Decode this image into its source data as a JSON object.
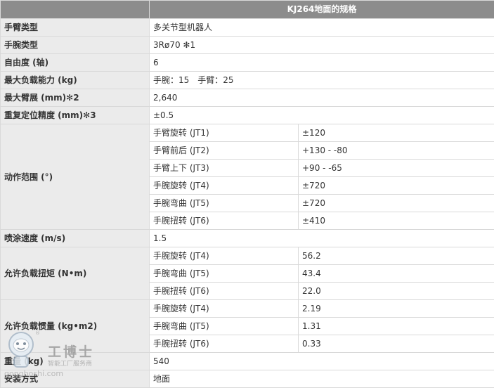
{
  "table": {
    "header": "KJ264地面的规格",
    "rows": [
      {
        "label": "手臂类型",
        "value": "多关节型机器人"
      },
      {
        "label": "手腕类型",
        "value": "3Rø70 ✻1"
      },
      {
        "label": "自由度 (轴)",
        "value": "6"
      },
      {
        "label": "最大负载能力 (kg)",
        "value": "手腕：15　手臂：25"
      },
      {
        "label": "最大臂展 (mm)✻2",
        "value": "2,640"
      },
      {
        "label": "重复定位精度 (mm)✻3",
        "value": "±0.5"
      }
    ],
    "motion": {
      "label": "动作范围 (°)",
      "items": [
        {
          "axis": "手臂旋转 (JT1)",
          "value": "±120"
        },
        {
          "axis": "手臂前后 (JT2)",
          "value": "+130 - -80"
        },
        {
          "axis": "手臂上下 (JT3)",
          "value": "+90 - -65"
        },
        {
          "axis": "手腕旋转 (JT4)",
          "value": "±720"
        },
        {
          "axis": "手腕弯曲 (JT5)",
          "value": "±720"
        },
        {
          "axis": "手腕扭转 (JT6)",
          "value": "±410"
        }
      ]
    },
    "spray_speed": {
      "label": "喷涂速度 (m/s)",
      "value": "1.5"
    },
    "torque": {
      "label": "允许负载扭矩 (N•m)",
      "items": [
        {
          "axis": "手腕旋转 (JT4)",
          "value": "56.2"
        },
        {
          "axis": "手腕弯曲 (JT5)",
          "value": "43.4"
        },
        {
          "axis": "手腕扭转 (JT6)",
          "value": "22.0"
        }
      ]
    },
    "inertia": {
      "label": "允许负载惯量 (kg•m2)",
      "items": [
        {
          "axis": "手腕旋转 (JT4)",
          "value": "2.19"
        },
        {
          "axis": "手腕弯曲 (JT5)",
          "value": "1.31"
        },
        {
          "axis": "手腕扭转 (JT6)",
          "value": "0.33"
        }
      ]
    },
    "weight": {
      "label": "重量 (kg)",
      "value": "540"
    },
    "mounting": {
      "label": "安装方式",
      "value": "地面"
    }
  },
  "watermark": {
    "brand": "工博士",
    "slogan": "智能工厂服务商",
    "url": "gongboshi.com",
    "reg": "®"
  }
}
